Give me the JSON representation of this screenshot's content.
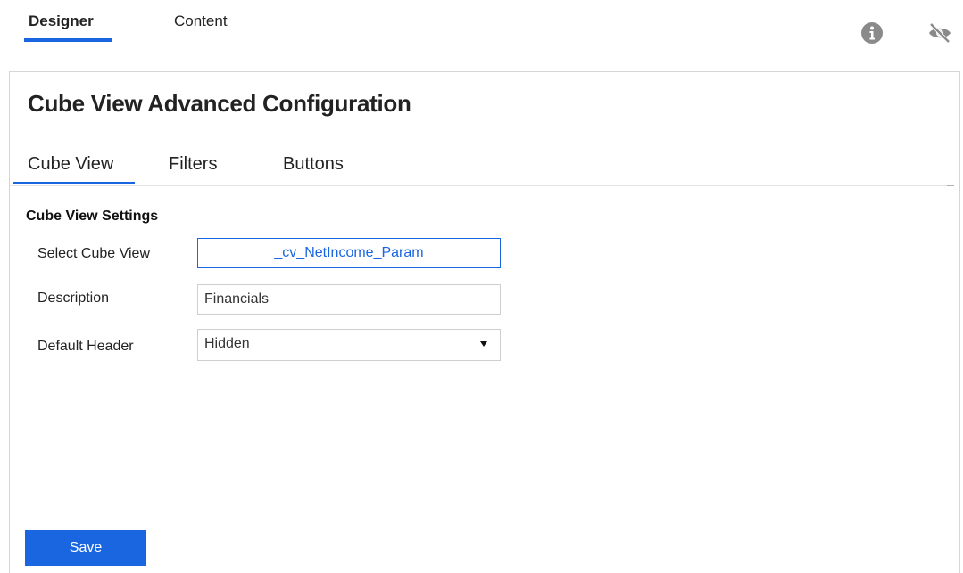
{
  "top_tabs": [
    {
      "label": "Designer",
      "active": true
    },
    {
      "label": "Content",
      "active": false
    }
  ],
  "toolbar": {
    "info_icon": "info-circle-icon",
    "visibility_icon": "eye-slash-icon"
  },
  "panel": {
    "title": "Cube View Advanced Configuration",
    "tabs": [
      {
        "label": "Cube View",
        "active": true
      },
      {
        "label": "Filters",
        "active": false
      },
      {
        "label": "Buttons",
        "active": false
      }
    ],
    "section_title": "Cube View Settings",
    "fields": {
      "select_cube_view": {
        "label": "Select Cube View",
        "value": "_cv_NetIncome_Param"
      },
      "description": {
        "label": "Description",
        "value": "Financials"
      },
      "default_header": {
        "label": "Default Header",
        "value": "Hidden"
      }
    },
    "save_label": "Save"
  },
  "colors": {
    "accent": "#1a66e0",
    "icon_gray": "#8a8a8a",
    "border": "#cfcfcf"
  }
}
